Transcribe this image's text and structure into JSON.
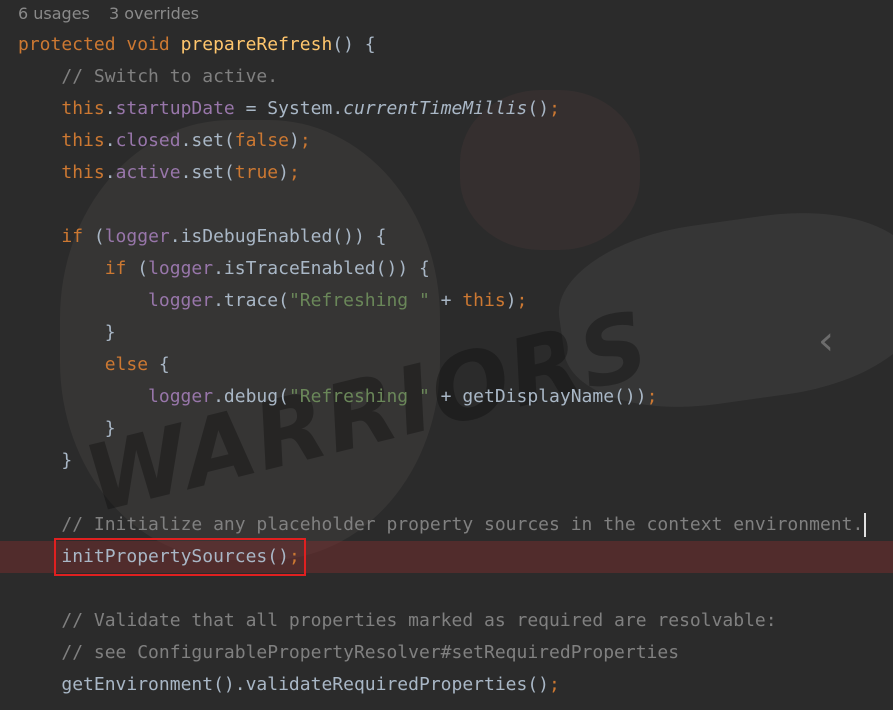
{
  "inlay_hints": {
    "usages": "6 usages",
    "overrides": "3 overrides"
  },
  "code_lines": [
    {
      "indent": "",
      "tokens": [
        {
          "t": "protected ",
          "c": "kw"
        },
        {
          "t": "void ",
          "c": "kw"
        },
        {
          "t": "prepareRefresh",
          "c": "fn"
        },
        {
          "t": "() {",
          "c": "id"
        }
      ]
    },
    {
      "indent": "    ",
      "tokens": [
        {
          "t": "// Switch to active.",
          "c": "cm"
        }
      ]
    },
    {
      "indent": "    ",
      "tokens": [
        {
          "t": "this",
          "c": "kw"
        },
        {
          "t": ".",
          "c": "id"
        },
        {
          "t": "startupDate",
          "c": "fld"
        },
        {
          "t": " = System.",
          "c": "id"
        },
        {
          "t": "currentTimeMillis",
          "c": "id it"
        },
        {
          "t": "()",
          "c": "id"
        },
        {
          "t": ";",
          "c": "kw"
        }
      ]
    },
    {
      "indent": "    ",
      "tokens": [
        {
          "t": "this",
          "c": "kw"
        },
        {
          "t": ".",
          "c": "id"
        },
        {
          "t": "closed",
          "c": "fld"
        },
        {
          "t": ".set(",
          "c": "id"
        },
        {
          "t": "false",
          "c": "kw"
        },
        {
          "t": ")",
          "c": "id"
        },
        {
          "t": ";",
          "c": "kw"
        }
      ]
    },
    {
      "indent": "    ",
      "tokens": [
        {
          "t": "this",
          "c": "kw"
        },
        {
          "t": ".",
          "c": "id"
        },
        {
          "t": "active",
          "c": "fld"
        },
        {
          "t": ".set(",
          "c": "id"
        },
        {
          "t": "true",
          "c": "kw"
        },
        {
          "t": ")",
          "c": "id"
        },
        {
          "t": ";",
          "c": "kw"
        }
      ]
    },
    {
      "indent": "",
      "tokens": []
    },
    {
      "indent": "    ",
      "tokens": [
        {
          "t": "if ",
          "c": "kw"
        },
        {
          "t": "(",
          "c": "id"
        },
        {
          "t": "logger",
          "c": "fld"
        },
        {
          "t": ".isDebugEnabled()) {",
          "c": "id"
        }
      ]
    },
    {
      "indent": "        ",
      "tokens": [
        {
          "t": "if ",
          "c": "kw"
        },
        {
          "t": "(",
          "c": "id"
        },
        {
          "t": "logger",
          "c": "fld"
        },
        {
          "t": ".isTraceEnabled()) {",
          "c": "id"
        }
      ]
    },
    {
      "indent": "            ",
      "tokens": [
        {
          "t": "logger",
          "c": "fld"
        },
        {
          "t": ".trace(",
          "c": "id"
        },
        {
          "t": "\"Refreshing \"",
          "c": "str"
        },
        {
          "t": " + ",
          "c": "id"
        },
        {
          "t": "this",
          "c": "kw"
        },
        {
          "t": ")",
          "c": "id"
        },
        {
          "t": ";",
          "c": "kw"
        }
      ]
    },
    {
      "indent": "        ",
      "tokens": [
        {
          "t": "}",
          "c": "id"
        }
      ]
    },
    {
      "indent": "        ",
      "tokens": [
        {
          "t": "else ",
          "c": "kw"
        },
        {
          "t": "{",
          "c": "id"
        }
      ]
    },
    {
      "indent": "            ",
      "tokens": [
        {
          "t": "logger",
          "c": "fld"
        },
        {
          "t": ".debug(",
          "c": "id"
        },
        {
          "t": "\"Refreshing \"",
          "c": "str"
        },
        {
          "t": " + getDisplayName())",
          "c": "id"
        },
        {
          "t": ";",
          "c": "kw"
        }
      ]
    },
    {
      "indent": "        ",
      "tokens": [
        {
          "t": "}",
          "c": "id"
        }
      ]
    },
    {
      "indent": "    ",
      "tokens": [
        {
          "t": "}",
          "c": "id"
        }
      ]
    },
    {
      "indent": "",
      "tokens": []
    },
    {
      "indent": "    ",
      "cursor": true,
      "tokens": [
        {
          "t": "// Initialize any placeholder property sources in the context environment.",
          "c": "cm"
        }
      ]
    },
    {
      "indent": "    ",
      "highlight": true,
      "tokens": [
        {
          "t": "initPropertySources()",
          "c": "id"
        },
        {
          "t": ";",
          "c": "kw"
        }
      ]
    },
    {
      "indent": "",
      "tokens": []
    },
    {
      "indent": "    ",
      "tokens": [
        {
          "t": "// Validate that all properties marked as required are resolvable:",
          "c": "cm"
        }
      ]
    },
    {
      "indent": "    ",
      "tokens": [
        {
          "t": "// see ConfigurablePropertyResolver#setRequiredProperties",
          "c": "cm"
        }
      ]
    },
    {
      "indent": "    ",
      "tokens": [
        {
          "t": "getEnvironment().validateRequiredProperties()",
          "c": "id"
        },
        {
          "t": ";",
          "c": "kw"
        }
      ]
    }
  ],
  "watermark": "WARRIORS",
  "colors": {
    "background": "#2b2b2b",
    "keyword": "#cc7832",
    "method_decl": "#ffc66d",
    "field": "#9876aa",
    "string": "#6a8759",
    "comment": "#808080",
    "identifier": "#a9b7c6",
    "highlight_box": "#e02020"
  }
}
